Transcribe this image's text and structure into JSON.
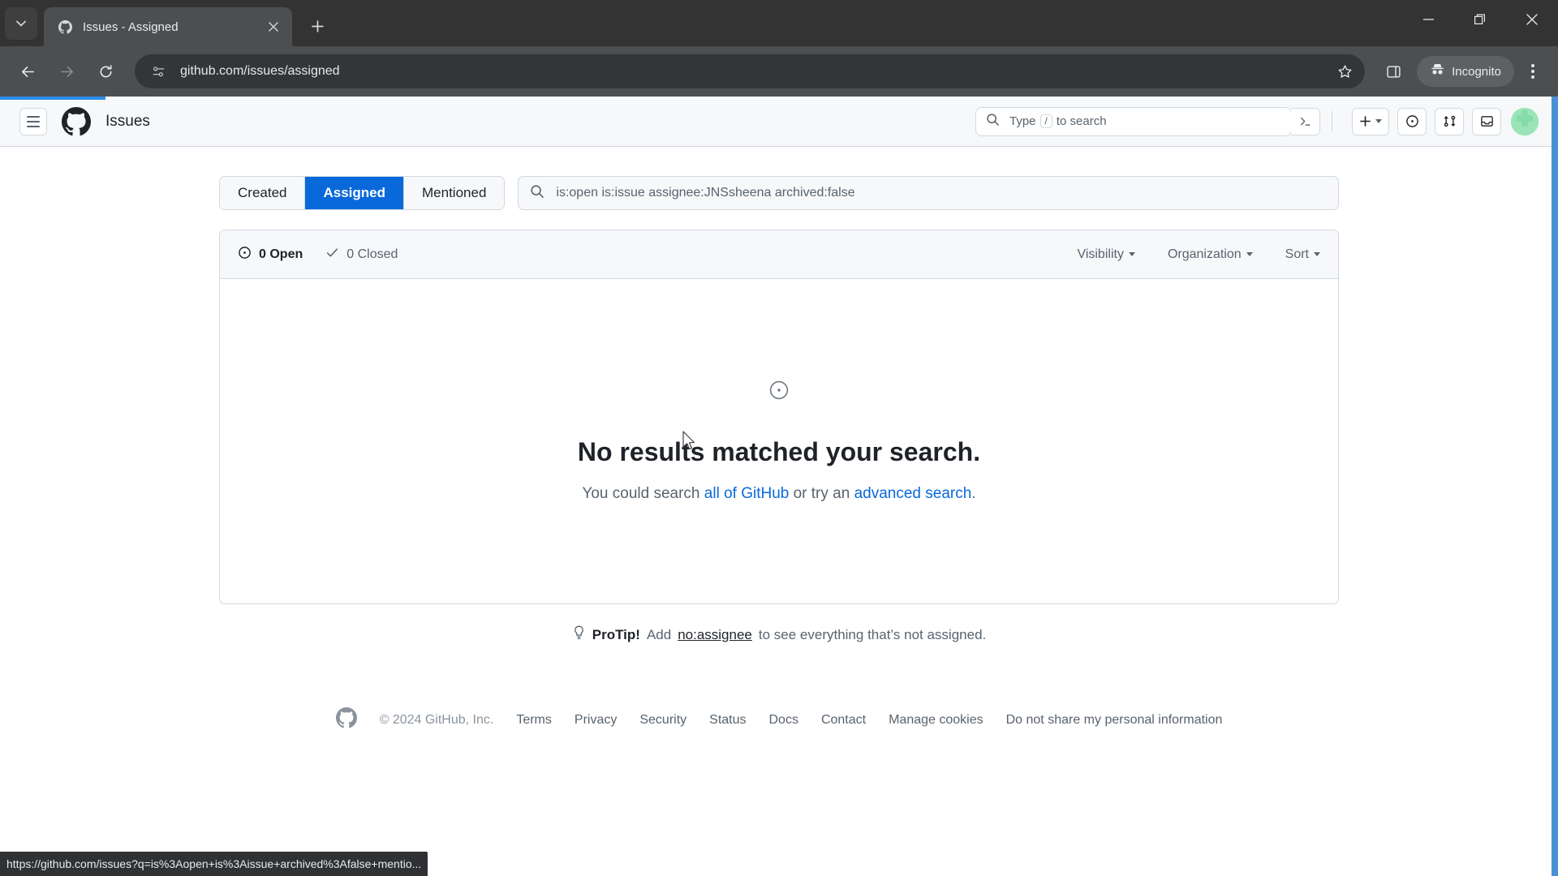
{
  "browser": {
    "tab": {
      "title": "Issues - Assigned",
      "favicon": "github-icon",
      "close_icon": "close-icon"
    },
    "tab_list_icon": "chevron-down-icon",
    "new_tab_icon": "plus-icon",
    "window_controls": {
      "minimize": "minimize-icon",
      "maximize": "restore-icon",
      "close": "close-icon"
    },
    "nav": {
      "back": "back-arrow-icon",
      "forward": "forward-arrow-icon",
      "reload": "reload-icon"
    },
    "omnibox": {
      "site_icon": "site-settings-icon",
      "url": "github.com/issues/assigned",
      "star_icon": "bookmark-star-icon"
    },
    "side_panel_icon": "side-panel-icon",
    "incognito": {
      "icon": "incognito-icon",
      "label": "Incognito"
    },
    "menu_icon": "kebab-menu-icon",
    "status_url": "https://github.com/issues?q=is%3Aopen+is%3Aissue+archived%3Afalse+mentio..."
  },
  "gh_header": {
    "hamburger": "hamburger-menu-icon",
    "logo": "github-logo-icon",
    "title": "Issues",
    "search": {
      "icon": "search-icon",
      "prefix": "Type",
      "key": "/",
      "suffix": "to search"
    },
    "command_palette_icon": "terminal-icon",
    "create_new_label": "plus-icon",
    "issues_icon": "issue-opened-icon",
    "pull_requests_icon": "pull-request-icon",
    "inbox_icon": "inbox-icon",
    "avatar": "user-avatar"
  },
  "filters": {
    "tabs": [
      {
        "label": "Created",
        "active": false
      },
      {
        "label": "Assigned",
        "active": true
      },
      {
        "label": "Mentioned",
        "active": false
      }
    ],
    "search_icon": "search-icon",
    "query": "is:open is:issue assignee:JNSsheena archived:false"
  },
  "results": {
    "open_icon": "issue-opened-icon",
    "open_count": "0 Open",
    "closed_icon": "check-icon",
    "closed_count": "0 Closed",
    "dropdowns": [
      {
        "label": "Visibility"
      },
      {
        "label": "Organization"
      },
      {
        "label": "Sort"
      }
    ],
    "empty": {
      "icon": "issue-opened-icon",
      "title": "No results matched your search.",
      "sub_prefix": "You could search ",
      "link1": "all of GitHub",
      "sub_middle": " or try an ",
      "link2": "advanced search",
      "sub_suffix": "."
    }
  },
  "protip": {
    "icon": "lightbulb-icon",
    "label": "ProTip!",
    "text_before": "Add",
    "link": "no:assignee",
    "text_after": "to see everything that’s not assigned."
  },
  "footer": {
    "logo": "github-logo-icon",
    "copyright": "© 2024 GitHub, Inc.",
    "links": [
      "Terms",
      "Privacy",
      "Security",
      "Status",
      "Docs",
      "Contact",
      "Manage cookies",
      "Do not share my personal information"
    ]
  },
  "colors": {
    "accent_blue": "#0969da",
    "progress_blue": "#2d8ceb",
    "scroll_blue": "#4a8fd4",
    "avatar_green": "#7ee2a8"
  }
}
